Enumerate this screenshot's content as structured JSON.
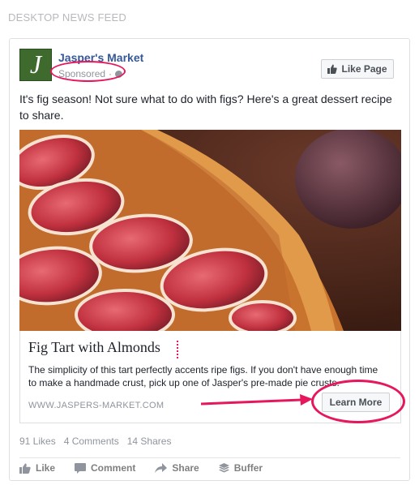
{
  "section": {
    "label": "DESKTOP NEWS FEED"
  },
  "post": {
    "page_name": "Jasper's Market",
    "avatar_letter": "J",
    "sponsored": "Sponsored",
    "meta_separator": "·",
    "like_page_label": "Like Page",
    "text": "It's fig season! Not sure what to do with figs? Here's a great dessert recipe to share.",
    "link": {
      "title": "Fig Tart with Almonds",
      "description": "The simplicity of this tart perfectly accents ripe figs. If you don't have enough time to make a handmade crust, pick up one of Jasper's pre-made pie crusts.",
      "domain": "WWW.JASPERS-MARKET.COM",
      "cta_label": "Learn More"
    },
    "stats": {
      "likes": "91 Likes",
      "comments": "4 Comments",
      "shares": "14 Shares"
    },
    "actions": {
      "like": "Like",
      "comment": "Comment",
      "share": "Share",
      "buffer": "Buffer"
    }
  },
  "colors": {
    "highlight": "#e6175c",
    "link_blue": "#365899",
    "avatar_green": "#3f6a2e"
  },
  "icons": [
    "thumbs-up-icon",
    "globe-icon",
    "comment-icon",
    "share-icon",
    "buffer-icon"
  ]
}
